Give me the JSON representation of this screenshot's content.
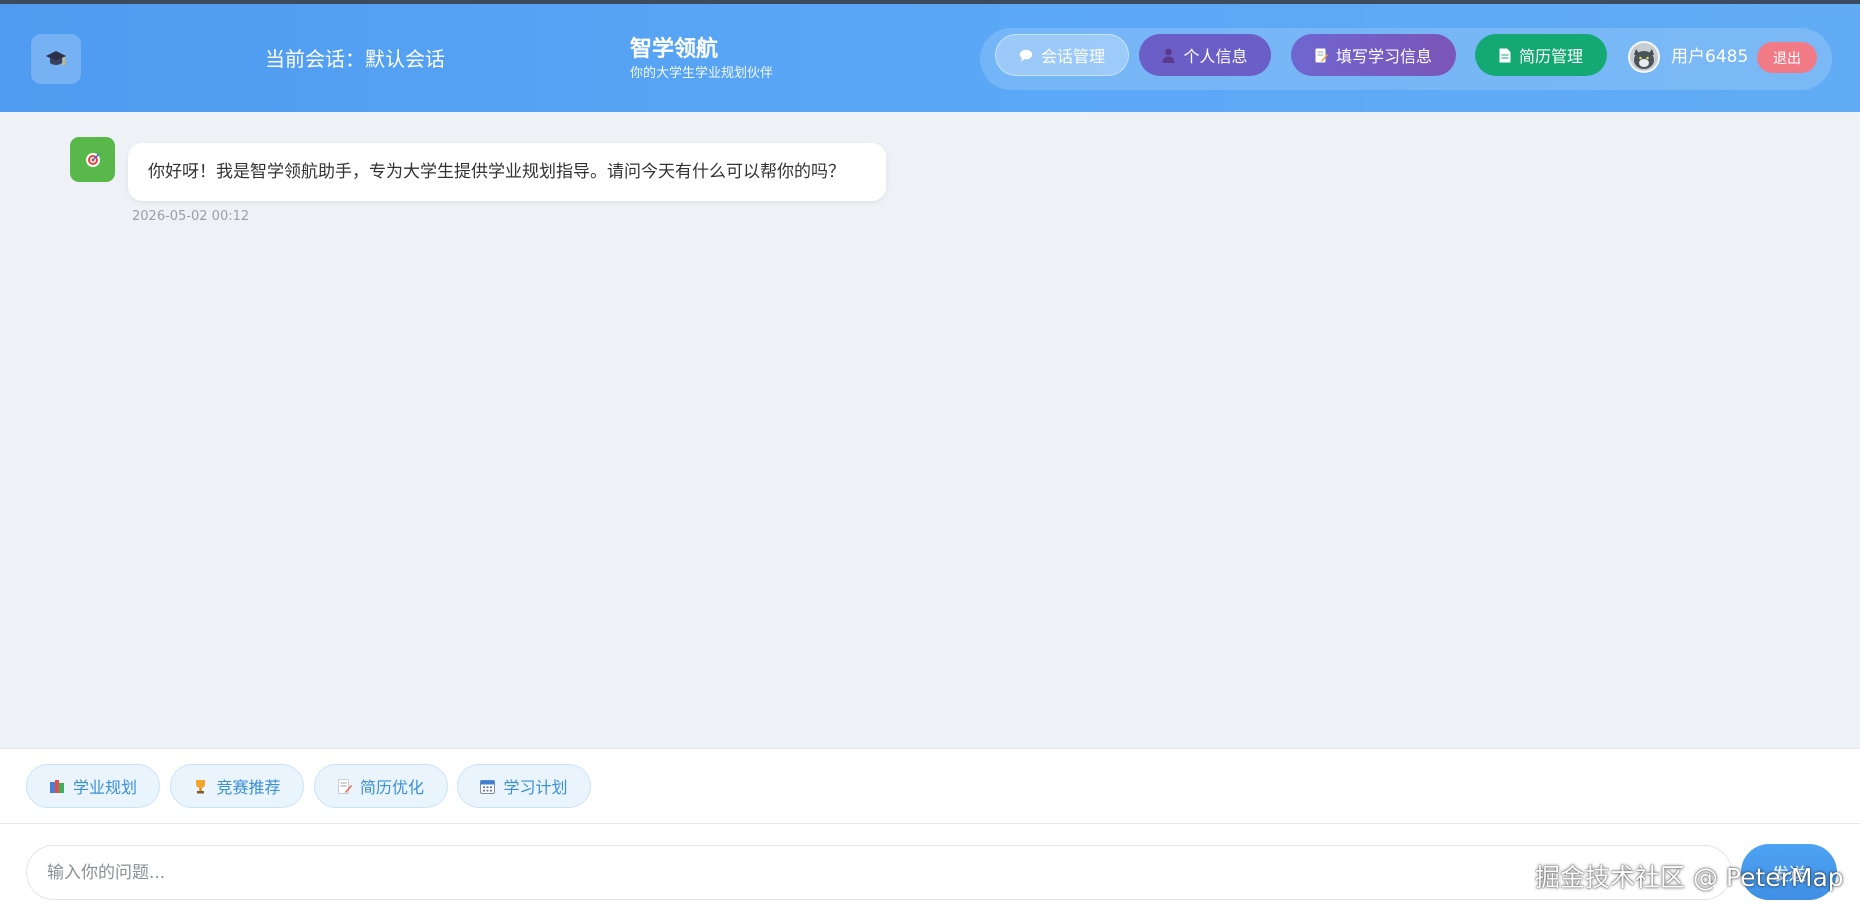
{
  "header": {
    "logo_icon": "graduation-cap-icon",
    "session_label": "当前会话：默认会话",
    "brand_title": "智学领航",
    "brand_subtitle": "你的大学生学业规划伙伴",
    "nav": {
      "session_manage": "会话管理",
      "profile": "个人信息",
      "study_info": "填写学习信息",
      "resume_manage": "简历管理"
    },
    "username": "用户6485",
    "logout": "退出"
  },
  "chat": {
    "messages": [
      {
        "sender": "bot",
        "avatar_icon": "target-icon",
        "text": "你好呀！我是智学领航助手，专为大学生提供学业规划指导。请问今天有什么可以帮你的吗？",
        "time": "2026-05-02 00:12"
      }
    ]
  },
  "quick_actions": [
    {
      "label": "学业规划",
      "icon": "books-icon"
    },
    {
      "label": "竞赛推荐",
      "icon": "trophy-icon"
    },
    {
      "label": "简历优化",
      "icon": "memo-icon"
    },
    {
      "label": "学习计划",
      "icon": "calendar-icon"
    }
  ],
  "composer": {
    "placeholder": "输入你的问题...",
    "send_label": "发送"
  },
  "watermark": "掘金技术社区 @ PeterMap",
  "colors": {
    "header_gradient_start": "#4f9bf1",
    "profile_button": "#6b5fc7",
    "resume_button": "#14a873",
    "logout_button": "#f07b86",
    "chip_text": "#3a8fd6"
  }
}
